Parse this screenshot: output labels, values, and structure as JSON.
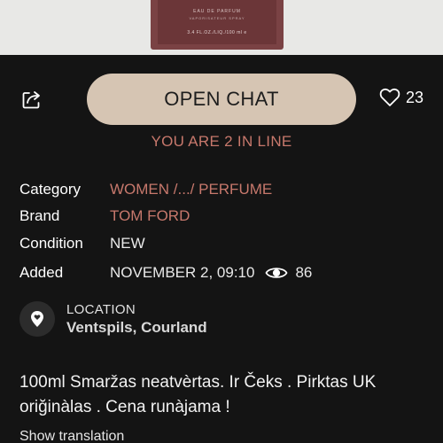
{
  "product_image": {
    "line1": "EAU DE PARFUM",
    "line2": "VAPORISATEUR SPRAY",
    "line3": "3.4 FL.OZ./LIQ./100 ml e"
  },
  "actions": {
    "chat_label": "OPEN CHAT",
    "likes_count": "23",
    "queue_text": "YOU ARE 2 IN LINE"
  },
  "details": {
    "category_label": "Category",
    "category_value": "WOMEN /.../ PERFUME",
    "brand_label": "Brand",
    "brand_value": "TOM FORD",
    "condition_label": "Condition",
    "condition_value": "NEW",
    "added_label": "Added",
    "added_value": "NOVEMBER 2, 09:10",
    "views_count": "86"
  },
  "location": {
    "label": "LOCATION",
    "value": "Ventspils, Courland"
  },
  "description": {
    "text": "100ml Smaržas neatvèrtas. Ir Čeks . Pirktas UK oriğinàlas . Cena runàjama !",
    "show_translation": "Show translation"
  },
  "colors": {
    "background": "#141414",
    "accent": "#c7786c",
    "chat_button": "#d6c5b3"
  },
  "icons": [
    "share-icon",
    "heart-icon",
    "eye-icon",
    "location-pin-icon"
  ]
}
